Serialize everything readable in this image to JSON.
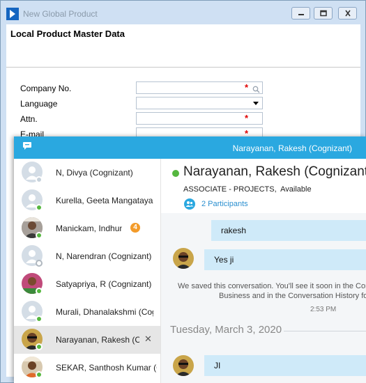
{
  "back_window": {
    "title": "New Global Product",
    "page_title": "Local Product Master Data",
    "fields": [
      {
        "label": "Company No.",
        "required": true,
        "lookup": true
      },
      {
        "label": "Language",
        "required": false,
        "dropdown": true
      },
      {
        "label": "Attn.",
        "required": true
      },
      {
        "label": "E-mail",
        "required": true
      }
    ],
    "required_marker": "*"
  },
  "chat": {
    "header_name": "Narayanan, Rakesh (Cognizant)",
    "contacts": [
      {
        "name": "N, Divya (Cognizant)",
        "presence": "unknown"
      },
      {
        "name": "Kurella, Geeta Mangatayaru",
        "presence": "available"
      },
      {
        "name": "Manickam, Indhumathi",
        "presence": "available",
        "badge": "4"
      },
      {
        "name": "N, Narendran (Cognizant)",
        "presence": "offline"
      },
      {
        "name": "Satyapriya, R (Cognizant)",
        "presence": "available"
      },
      {
        "name": "Murali, Dhanalakshmi (Cognizant)",
        "presence": "available"
      },
      {
        "name": "Narayanan, Rakesh (Cognizant)",
        "presence": "available",
        "selected": true,
        "close": "✕"
      },
      {
        "name": "SEKAR, Santhosh Kumar (Cognizant)",
        "presence": "available"
      }
    ],
    "conversation": {
      "name": "Narayanan, Rakesh (Cognizant)",
      "role": "ASSOCIATE - PROJECTS",
      "status": "Available",
      "participants": "2 Participants",
      "messages": [
        {
          "text": "rakesh",
          "own": true
        },
        {
          "text": "Yes ji",
          "own": false
        }
      ],
      "notice_line1": "We saved this conversation. You'll see it soon in the Conversations tab in Skype for",
      "notice_line2": "Business and in the Conversation History folder in Outlook.",
      "notice_time": "2:53 PM",
      "date_separator": "Tuesday, March 3, 2020",
      "last_message": "JI"
    }
  },
  "colors": {
    "skype_blue": "#2aa8e0",
    "bubble": "#cfeaf9",
    "presence_green": "#55b73f",
    "required_red": "#e00000",
    "badge_orange": "#f39b2a"
  }
}
